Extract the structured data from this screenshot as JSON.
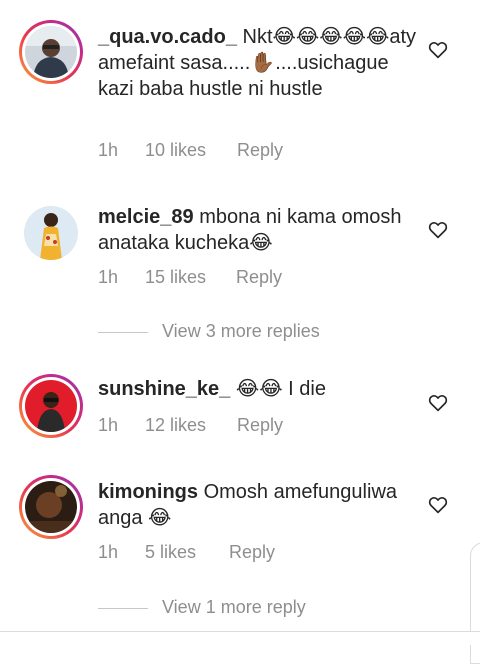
{
  "comments": [
    {
      "username": "_qua.vo.cado_",
      "text": "Nkt😂😂😂😂😂aty amefaint sasa.....✋🏾....usichague kazi baba hustle ni hustle",
      "time": "1h",
      "likes": "10 likes",
      "reply": "Reply"
    },
    {
      "username": "melcie_89",
      "text": "mbona ni kama omosh anataka kucheka😂",
      "time": "1h",
      "likes": "15 likes",
      "reply": "Reply"
    },
    {
      "username": "sunshine_ke_",
      "text": "😂😂 I die",
      "time": "1h",
      "likes": "12 likes",
      "reply": "Reply"
    },
    {
      "username": "kimonings",
      "text": "Omosh amefunguliwa anga 😂",
      "time": "1h",
      "likes": "5 likes",
      "reply": "Reply"
    }
  ],
  "view_replies": [
    "View 3 more replies",
    "View 1 more reply"
  ],
  "icons": {
    "like": "heart-outline-icon"
  },
  "colors": {
    "text": "#262626",
    "secondary": "#8e8e8e",
    "story_ring": "#e8344f"
  }
}
